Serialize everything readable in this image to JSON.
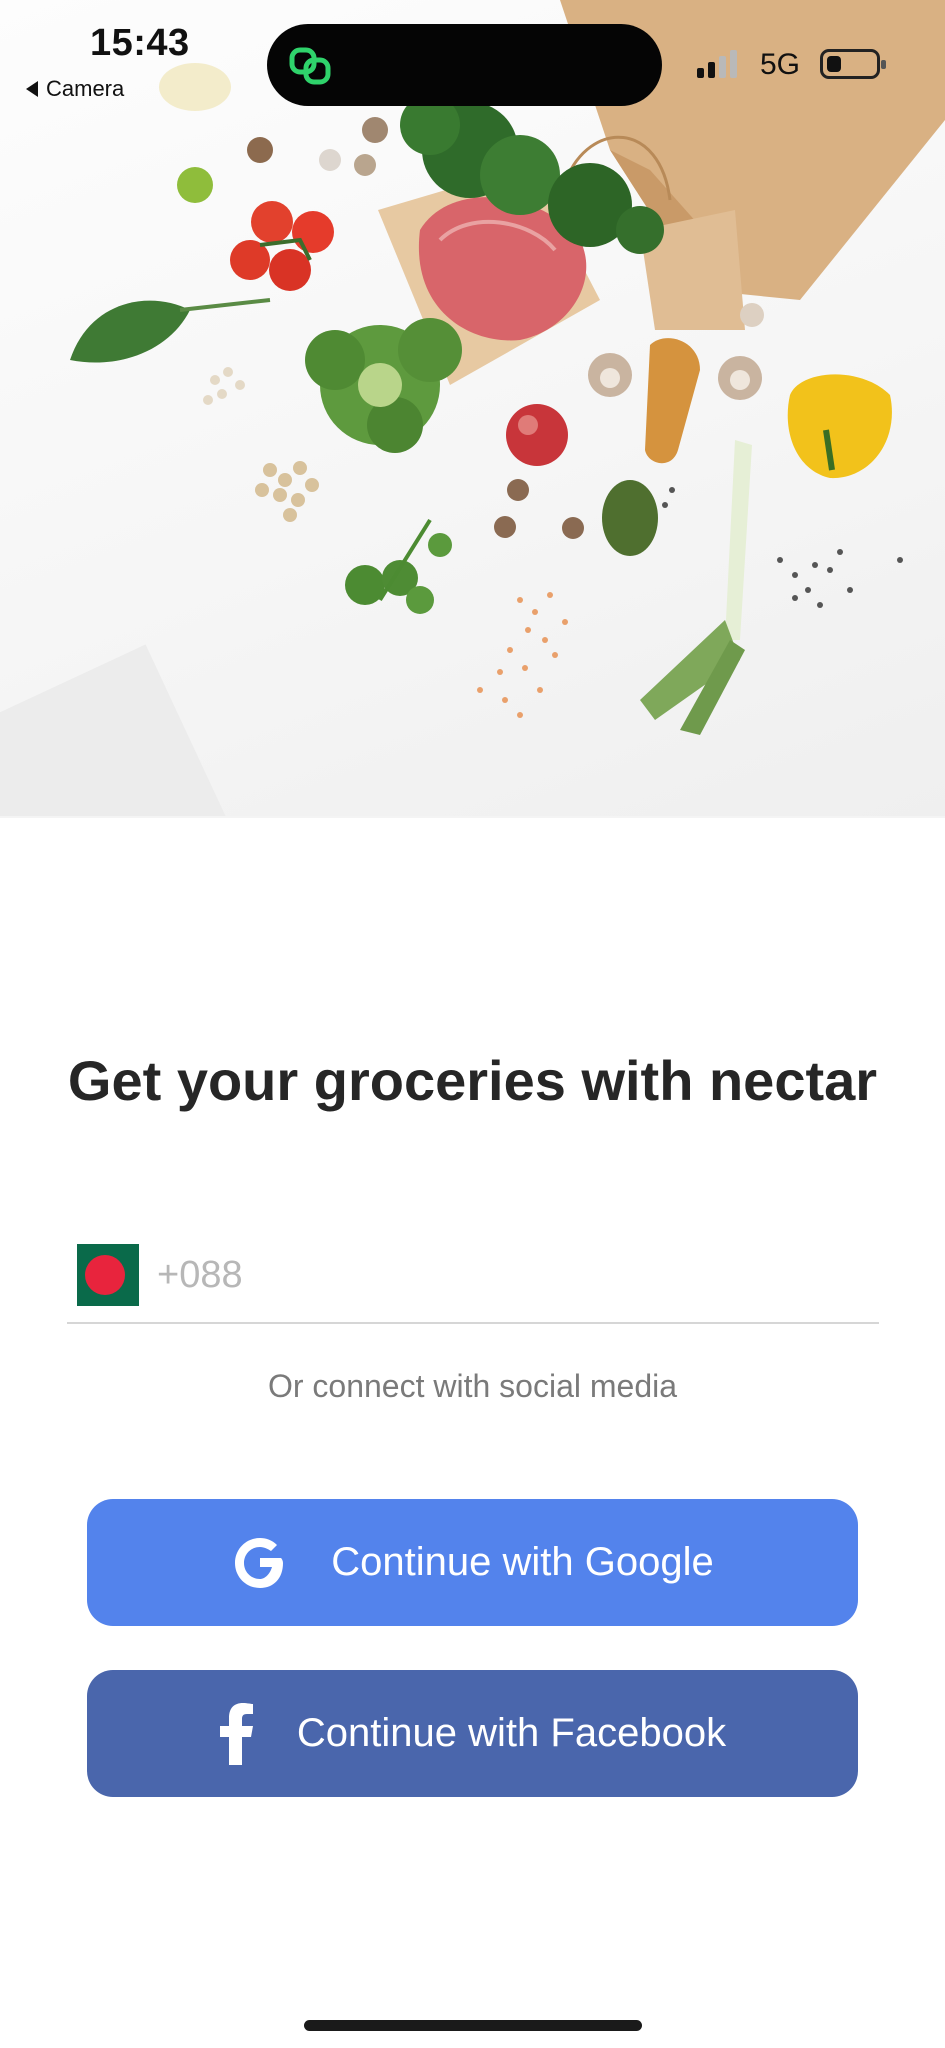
{
  "status_bar": {
    "time": "15:43",
    "back_label": "Camera",
    "network": "5G",
    "island_icon": "link-rings-icon",
    "island_icon_color": "#2fd36b"
  },
  "hero": {
    "image": "groceries-photo",
    "items": [
      "paper-bag",
      "steak",
      "broccoli",
      "tomatoes",
      "spinach-leaf",
      "parsley",
      "apple",
      "mushrooms",
      "baguette",
      "yellow-pepper",
      "avocado",
      "leek",
      "lentils",
      "quail-eggs",
      "lime",
      "lemon"
    ]
  },
  "main": {
    "headline": "Get your groceries with nectar",
    "phone": {
      "flag": "bangladesh-flag",
      "placeholder": "+088",
      "value": ""
    },
    "social_caption": "Or connect with social media",
    "google_button": "Continue with Google",
    "facebook_button": "Continue with Facebook"
  },
  "colors": {
    "google_blue": "#5383ec",
    "facebook_blue": "#4a66ac",
    "headline": "#262626",
    "caption": "#7a7a7a",
    "flag_green": "#0a6a4a",
    "flag_red": "#e8243d"
  }
}
